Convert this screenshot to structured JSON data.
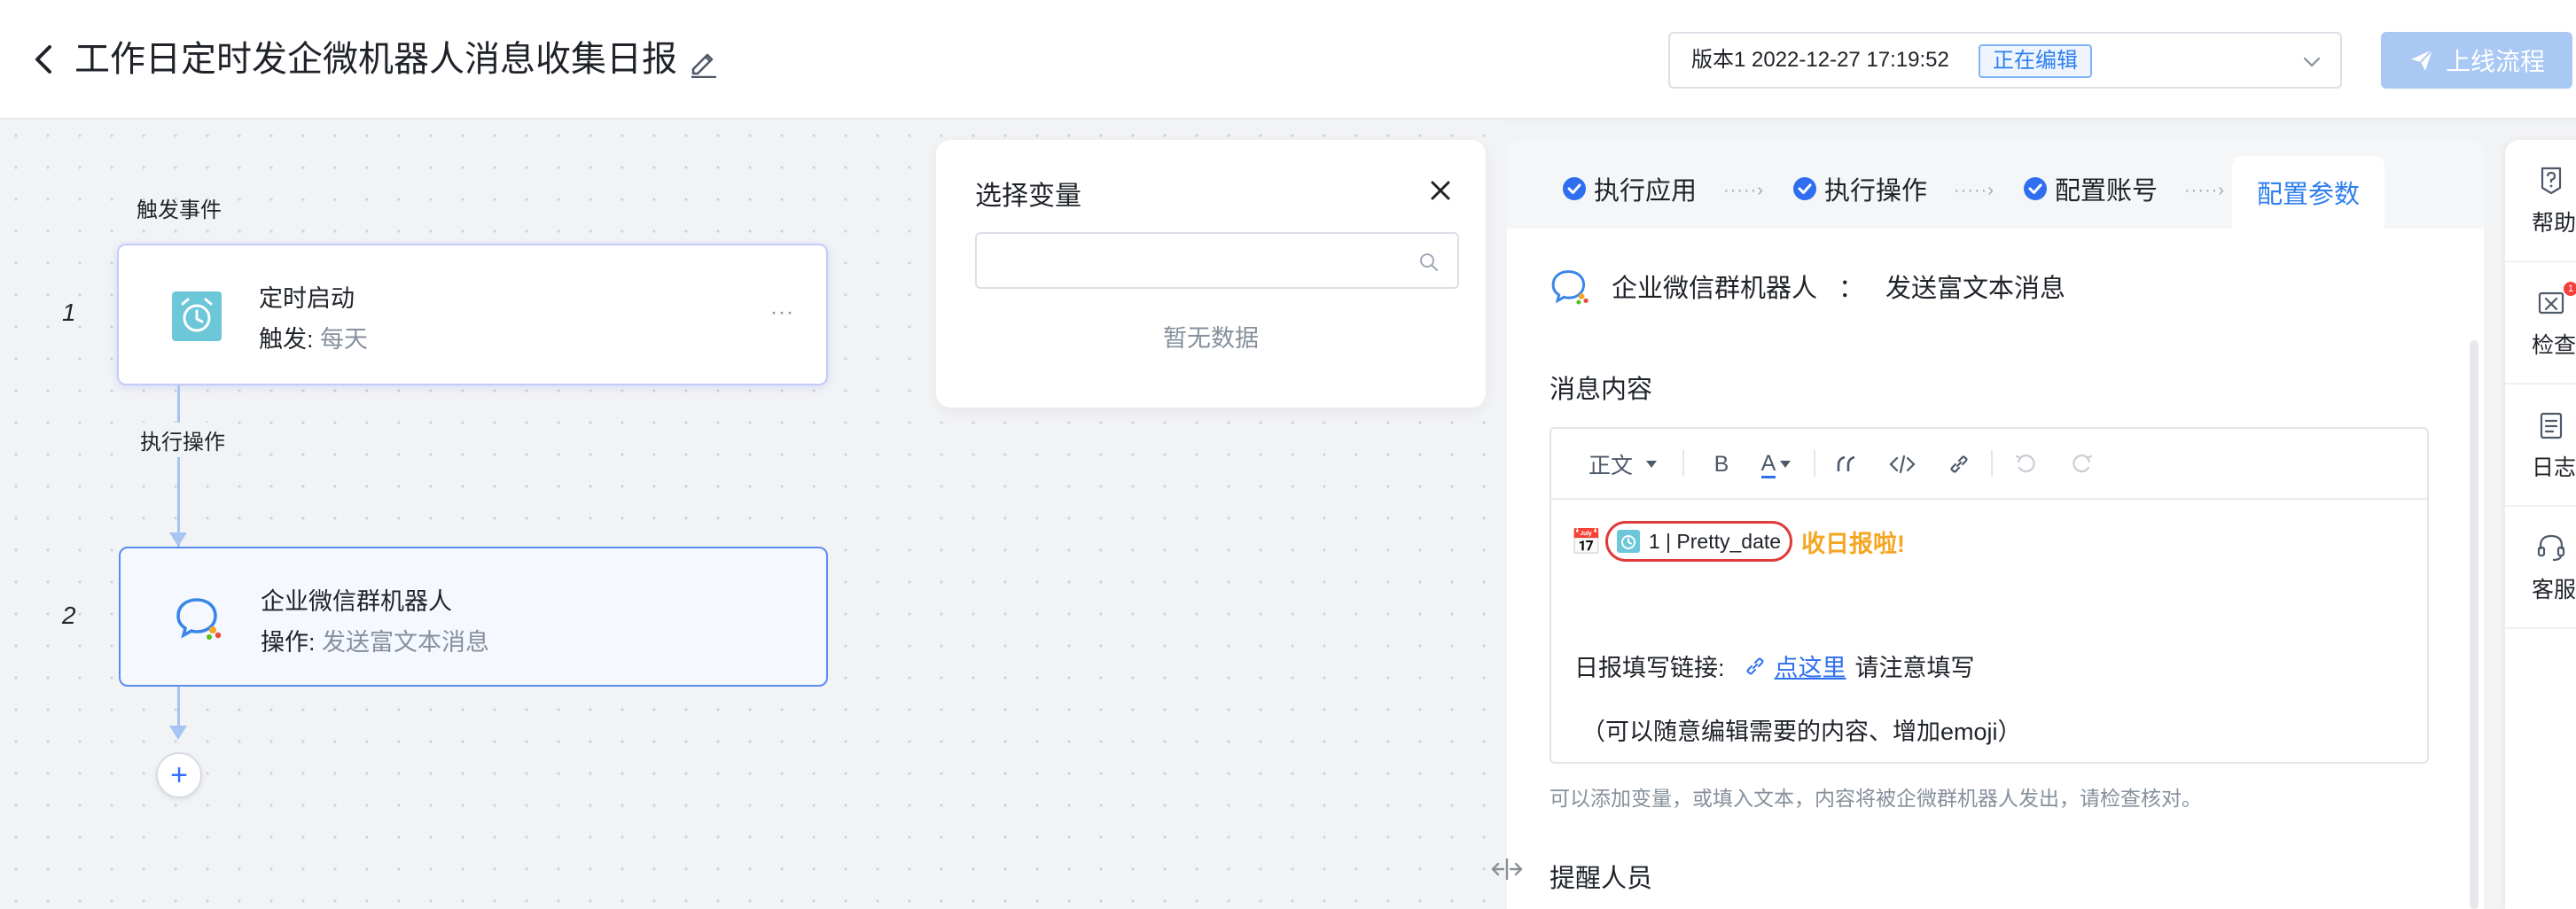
{
  "header": {
    "back_label": "<",
    "title": "工作日定时发企微机器人消息收集日报",
    "version_text": "版本1  2022-12-27 17:19:52",
    "version_status": "正在编辑",
    "publish_label": "上线流程"
  },
  "canvas": {
    "trigger_label": "触发事件",
    "action_label": "执行操作",
    "add_label": "+",
    "nodes": [
      {
        "index": "1",
        "title": "定时启动",
        "sub_key": "触发:",
        "sub_value": "每天",
        "more": "···"
      },
      {
        "index": "2",
        "title": "企业微信群机器人",
        "sub_key": "操作:",
        "sub_value": "发送富文本消息"
      }
    ]
  },
  "variable_panel": {
    "title": "选择变量",
    "search_placeholder": "",
    "empty_text": "暂无数据"
  },
  "config": {
    "steps": [
      {
        "label": "执行应用",
        "done": true
      },
      {
        "label": "执行操作",
        "done": true
      },
      {
        "label": "配置账号",
        "done": true
      },
      {
        "label": "配置参数",
        "active": true
      }
    ],
    "step_separator": "·····›",
    "app_name": "企业微信群机器人",
    "app_colon": "：",
    "app_action": "发送富文本消息",
    "message_section": "消息内容",
    "toolbar": {
      "paragraph": "正文",
      "bold": "B",
      "font_color": "A"
    },
    "editor": {
      "emoji": "📅",
      "variable_chip": "1 | Pretty_date",
      "highlight": "收日报啦!",
      "link_prefix": "日报填写链接:",
      "link_text": "点这里",
      "link_suffix": "请注意填写",
      "note": "（可以随意编辑需要的内容、增加emoji）"
    },
    "hint": "可以添加变量，或填入文本，内容将被企微群机器人发出，请检查核对。",
    "remind_section": "提醒人员"
  },
  "rail": {
    "items": [
      {
        "label": "帮助",
        "icon": "help-icon"
      },
      {
        "label": "检查",
        "icon": "check-icon",
        "badge": "1"
      },
      {
        "label": "日志",
        "icon": "log-icon"
      },
      {
        "label": "客服",
        "icon": "headset-icon"
      }
    ]
  },
  "colors": {
    "primary": "#2f7fef",
    "publish_disabled": "#a9c8f4",
    "highlight": "#f5a623",
    "chip_border": "#e03a3a"
  }
}
